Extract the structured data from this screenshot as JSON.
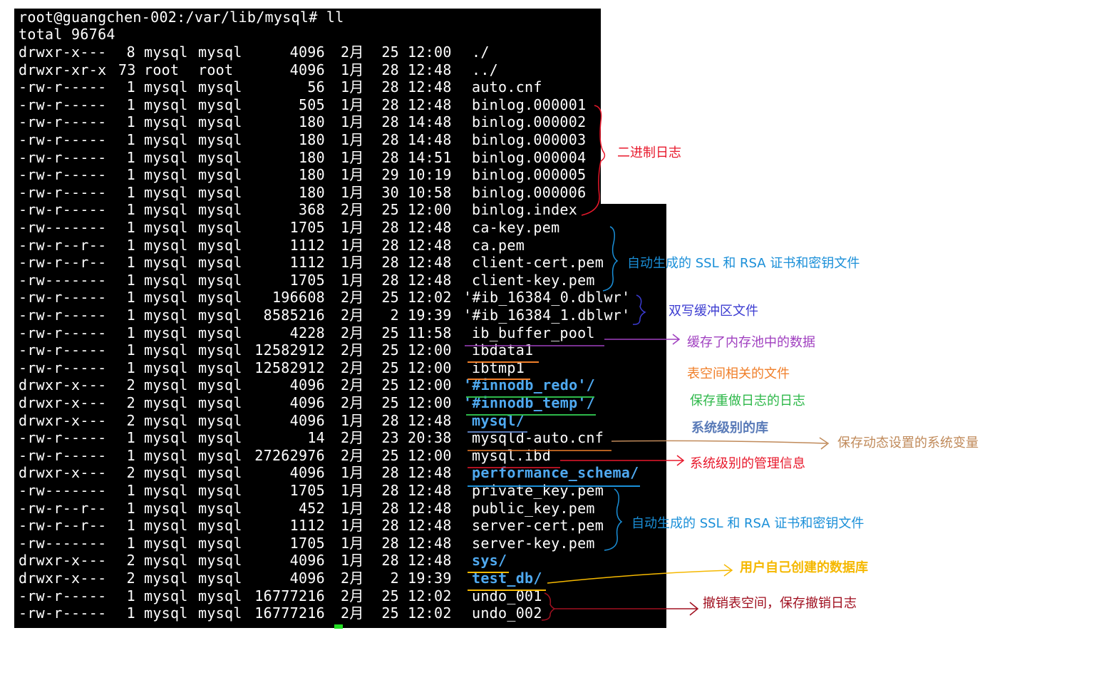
{
  "terminal": {
    "prompt": "root@guangchen-002:/var/lib/mysql# ll",
    "total": "total 96764",
    "rows": [
      {
        "perm": "drwxr-x---",
        "links": "8",
        "owner": "mysql",
        "group": "mysql",
        "size": "4096",
        "month": "2月",
        "day": "25",
        "time": "12:00",
        "name": "./",
        "dir": false
      },
      {
        "perm": "drwxr-xr-x",
        "links": "73",
        "owner": "root",
        "group": "root",
        "size": "4096",
        "month": "1月",
        "day": "28",
        "time": "12:48",
        "name": "../",
        "dir": false
      },
      {
        "perm": "-rw-r-----",
        "links": "1",
        "owner": "mysql",
        "group": "mysql",
        "size": "56",
        "month": "1月",
        "day": "28",
        "time": "12:48",
        "name": "auto.cnf",
        "dir": false
      },
      {
        "perm": "-rw-r-----",
        "links": "1",
        "owner": "mysql",
        "group": "mysql",
        "size": "505",
        "month": "1月",
        "day": "28",
        "time": "12:48",
        "name": "binlog.000001",
        "dir": false
      },
      {
        "perm": "-rw-r-----",
        "links": "1",
        "owner": "mysql",
        "group": "mysql",
        "size": "180",
        "month": "1月",
        "day": "28",
        "time": "14:48",
        "name": "binlog.000002",
        "dir": false
      },
      {
        "perm": "-rw-r-----",
        "links": "1",
        "owner": "mysql",
        "group": "mysql",
        "size": "180",
        "month": "1月",
        "day": "28",
        "time": "14:48",
        "name": "binlog.000003",
        "dir": false
      },
      {
        "perm": "-rw-r-----",
        "links": "1",
        "owner": "mysql",
        "group": "mysql",
        "size": "180",
        "month": "1月",
        "day": "28",
        "time": "14:51",
        "name": "binlog.000004",
        "dir": false
      },
      {
        "perm": "-rw-r-----",
        "links": "1",
        "owner": "mysql",
        "group": "mysql",
        "size": "180",
        "month": "1月",
        "day": "29",
        "time": "10:19",
        "name": "binlog.000005",
        "dir": false
      },
      {
        "perm": "-rw-r-----",
        "links": "1",
        "owner": "mysql",
        "group": "mysql",
        "size": "180",
        "month": "1月",
        "day": "30",
        "time": "10:58",
        "name": "binlog.000006",
        "dir": false
      },
      {
        "perm": "-rw-r-----",
        "links": "1",
        "owner": "mysql",
        "group": "mysql",
        "size": "368",
        "month": "2月",
        "day": "25",
        "time": "12:00",
        "name": "binlog.index",
        "dir": false
      },
      {
        "perm": "-rw-------",
        "links": "1",
        "owner": "mysql",
        "group": "mysql",
        "size": "1705",
        "month": "1月",
        "day": "28",
        "time": "12:48",
        "name": "ca-key.pem",
        "dir": false
      },
      {
        "perm": "-rw-r--r--",
        "links": "1",
        "owner": "mysql",
        "group": "mysql",
        "size": "1112",
        "month": "1月",
        "day": "28",
        "time": "12:48",
        "name": "ca.pem",
        "dir": false
      },
      {
        "perm": "-rw-r--r--",
        "links": "1",
        "owner": "mysql",
        "group": "mysql",
        "size": "1112",
        "month": "1月",
        "day": "28",
        "time": "12:48",
        "name": "client-cert.pem",
        "dir": false
      },
      {
        "perm": "-rw-------",
        "links": "1",
        "owner": "mysql",
        "group": "mysql",
        "size": "1705",
        "month": "1月",
        "day": "28",
        "time": "12:48",
        "name": "client-key.pem",
        "dir": false
      },
      {
        "perm": "-rw-r-----",
        "links": "1",
        "owner": "mysql",
        "group": "mysql",
        "size": "196608",
        "month": "2月",
        "day": "25",
        "time": "12:02",
        "name": "'#ib_16384_0.dblwr'",
        "dir": false
      },
      {
        "perm": "-rw-r-----",
        "links": "1",
        "owner": "mysql",
        "group": "mysql",
        "size": "8585216",
        "month": "2月",
        "day": "2",
        "time": "19:39",
        "name": "'#ib_16384_1.dblwr'",
        "dir": false
      },
      {
        "perm": "-rw-r-----",
        "links": "1",
        "owner": "mysql",
        "group": "mysql",
        "size": "4228",
        "month": "2月",
        "day": "25",
        "time": "11:58",
        "name": "ib_buffer_pool",
        "dir": false
      },
      {
        "perm": "-rw-r-----",
        "links": "1",
        "owner": "mysql",
        "group": "mysql",
        "size": "12582912",
        "month": "2月",
        "day": "25",
        "time": "12:00",
        "name": "ibdata1",
        "dir": false
      },
      {
        "perm": "-rw-r-----",
        "links": "1",
        "owner": "mysql",
        "group": "mysql",
        "size": "12582912",
        "month": "2月",
        "day": "25",
        "time": "12:00",
        "name": "ibtmp1",
        "dir": false
      },
      {
        "perm": "drwxr-x---",
        "links": "2",
        "owner": "mysql",
        "group": "mysql",
        "size": "4096",
        "month": "2月",
        "day": "25",
        "time": "12:00",
        "name": "'#innodb_redo'/",
        "dir": true
      },
      {
        "perm": "drwxr-x---",
        "links": "2",
        "owner": "mysql",
        "group": "mysql",
        "size": "4096",
        "month": "2月",
        "day": "25",
        "time": "12:00",
        "name": "'#innodb_temp'/",
        "dir": true
      },
      {
        "perm": "drwxr-x---",
        "links": "2",
        "owner": "mysql",
        "group": "mysql",
        "size": "4096",
        "month": "1月",
        "day": "28",
        "time": "12:48",
        "name": "mysql/",
        "dir": true
      },
      {
        "perm": "-rw-r-----",
        "links": "1",
        "owner": "mysql",
        "group": "mysql",
        "size": "14",
        "month": "2月",
        "day": "23",
        "time": "20:38",
        "name": "mysqld-auto.cnf",
        "dir": false
      },
      {
        "perm": "-rw-r-----",
        "links": "1",
        "owner": "mysql",
        "group": "mysql",
        "size": "27262976",
        "month": "2月",
        "day": "25",
        "time": "12:00",
        "name": "mysql.ibd",
        "dir": false
      },
      {
        "perm": "drwxr-x---",
        "links": "2",
        "owner": "mysql",
        "group": "mysql",
        "size": "4096",
        "month": "1月",
        "day": "28",
        "time": "12:48",
        "name": "performance_schema/",
        "dir": true
      },
      {
        "perm": "-rw-------",
        "links": "1",
        "owner": "mysql",
        "group": "mysql",
        "size": "1705",
        "month": "1月",
        "day": "28",
        "time": "12:48",
        "name": "private_key.pem",
        "dir": false
      },
      {
        "perm": "-rw-r--r--",
        "links": "1",
        "owner": "mysql",
        "group": "mysql",
        "size": "452",
        "month": "1月",
        "day": "28",
        "time": "12:48",
        "name": "public_key.pem",
        "dir": false
      },
      {
        "perm": "-rw-r--r--",
        "links": "1",
        "owner": "mysql",
        "group": "mysql",
        "size": "1112",
        "month": "1月",
        "day": "28",
        "time": "12:48",
        "name": "server-cert.pem",
        "dir": false
      },
      {
        "perm": "-rw-------",
        "links": "1",
        "owner": "mysql",
        "group": "mysql",
        "size": "1705",
        "month": "1月",
        "day": "28",
        "time": "12:48",
        "name": "server-key.pem",
        "dir": false
      },
      {
        "perm": "drwxr-x---",
        "links": "2",
        "owner": "mysql",
        "group": "mysql",
        "size": "4096",
        "month": "1月",
        "day": "28",
        "time": "12:48",
        "name": "sys/",
        "dir": true
      },
      {
        "perm": "drwxr-x---",
        "links": "2",
        "owner": "mysql",
        "group": "mysql",
        "size": "4096",
        "month": "2月",
        "day": "2",
        "time": "19:39",
        "name": "test_db/",
        "dir": true
      },
      {
        "perm": "-rw-r-----",
        "links": "1",
        "owner": "mysql",
        "group": "mysql",
        "size": "16777216",
        "month": "2月",
        "day": "25",
        "time": "12:02",
        "name": "undo_001",
        "dir": false
      },
      {
        "perm": "-rw-r-----",
        "links": "1",
        "owner": "mysql",
        "group": "mysql",
        "size": "16777216",
        "month": "2月",
        "day": "25",
        "time": "12:02",
        "name": "undo_002",
        "dir": false
      }
    ]
  },
  "annotations": {
    "binlog": {
      "text": "二进制日志",
      "color": "#e8192c"
    },
    "ssl1": {
      "text": "自动生成的 SSL 和 RSA 证书和密钥文件",
      "color": "#1a8fd8"
    },
    "dblwr": {
      "text": "双写缓冲区文件",
      "color": "#3b3bd1"
    },
    "buffer_pool": {
      "text": "缓存了内存池中的数据",
      "color": "#a040c0"
    },
    "tablespace": {
      "text": "表空间相关的文件",
      "color": "#f07f2a"
    },
    "redo": {
      "text": "保存重做日志的日志",
      "color": "#2eb84a"
    },
    "syslib": {
      "text": "系统级别的库",
      "color": "#5a7bb8"
    },
    "auto_cnf": {
      "text": "保存动态设置的系统变量",
      "color": "#c08a5a"
    },
    "mysql_ibd": {
      "text": "系统级别的管理信息",
      "color": "#e8192c"
    },
    "ssl2": {
      "text": "自动生成的 SSL 和 RSA 证书和密钥文件",
      "color": "#1a8fd8"
    },
    "user_db": {
      "text": "用户自己创建的数据库",
      "color": "#f5b800"
    },
    "undo": {
      "text": "撤销表空间，保存撤销日志",
      "color": "#a01020"
    }
  }
}
